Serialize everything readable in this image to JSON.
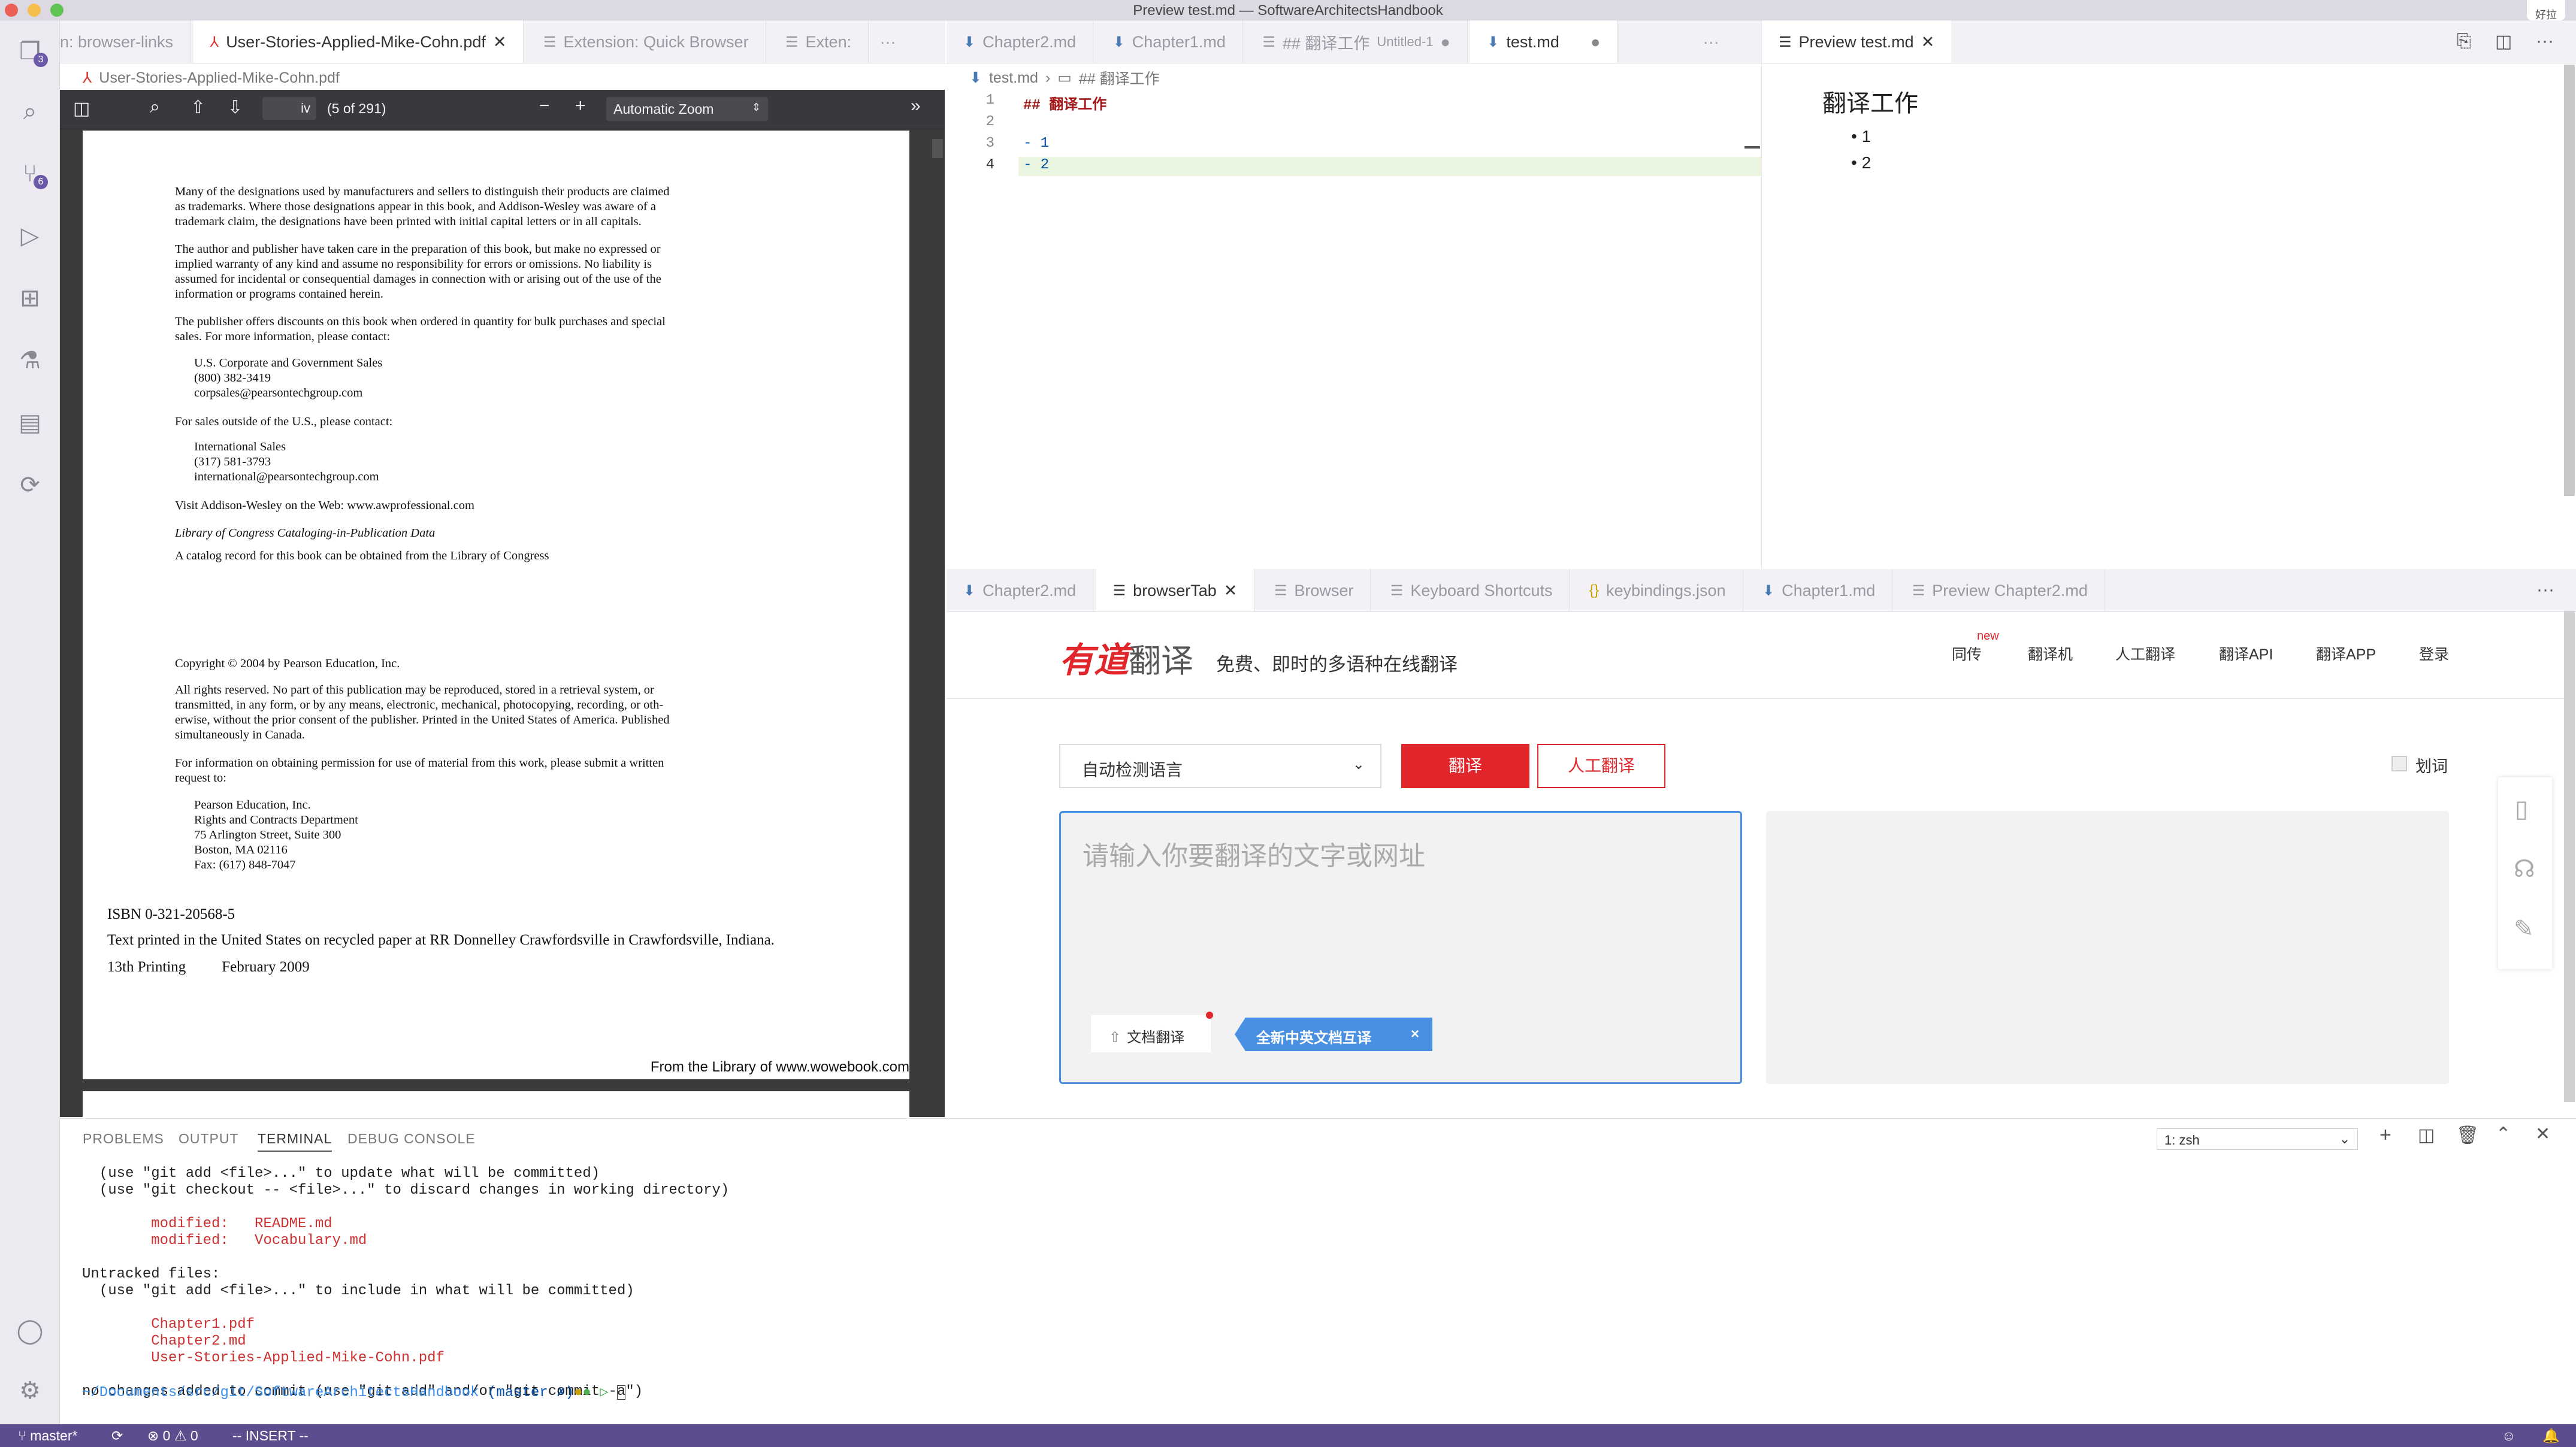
{
  "window_title": "Preview test.md — SoftwareArchitectsHandbook",
  "activity": {
    "badges": {
      "explorer": "3",
      "scm": "6"
    }
  },
  "pdf_group": {
    "tabs": [
      "n: browser-links",
      "User-Stories-Applied-Mike-Cohn.pdf",
      "Extension: Quick Browser",
      "Exten:"
    ],
    "breadcrumb": "User-Stories-Applied-Mike-Cohn.pdf",
    "toolbar": {
      "page_input": "iv",
      "page_count": "(5 of 291)",
      "zoom": "Automatic Zoom"
    },
    "page": {
      "p1": [
        "Many of the designations used by manufacturers and sellers to distinguish their products are claimed",
        "as trademarks. Where those designations appear in this book, and Addison-Wesley was aware of a",
        "trademark claim, the designations have been printed with initial capital letters or in all capitals."
      ],
      "p2": [
        "The author and publisher have taken care in the preparation of this book, but make no expressed or",
        "implied warranty of any kind and assume no responsibility for errors or omissions. No liability is",
        "assumed for incidental or consequential damages in connection with or arising out of the use of the",
        "information or programs contained herein."
      ],
      "p3": [
        "The publisher offers discounts on this book when ordered in quantity for bulk purchases and special",
        "sales. For more information, please contact:"
      ],
      "us_contact": [
        "U.S. Corporate and Government Sales",
        "(800) 382-3419",
        "corpsales@pearsontechgroup.com"
      ],
      "outside": "For sales outside of the U.S., please contact:",
      "intl_contact": [
        "International Sales",
        "(317) 581-3793",
        "international@pearsontechgroup.com"
      ],
      "visit": "Visit Addison-Wesley on the Web: www.awprofessional.com",
      "loc_title": "Library of Congress Cataloging-in-Publication Data",
      "loc_text": "A catalog record for this book can be obtained from the Library of Congress",
      "copyright": "Copyright © 2004 by Pearson Education, Inc.",
      "rights": [
        "All rights reserved. No part of this publication may be reproduced, stored in a retrieval system, or",
        "transmitted, in any form, or by any means, electronic, mechanical, photocopying, recording, or oth-",
        "erwise, without the prior consent of the publisher. Printed in the United States of America. Published",
        "simultaneously in Canada."
      ],
      "permission": [
        "For information on obtaining permission for use of material from this work, please submit a written",
        "request to:"
      ],
      "address": [
        "Pearson Education, Inc.",
        "Rights and Contracts Department",
        "75 Arlington Street, Suite 300",
        "Boston, MA 02116",
        "Fax: (617) 848-7047"
      ],
      "isbn": "ISBN  0-321-20568-5",
      "printed": "Text printed in the United States on recycled paper at RR Donnelley Crawfordsville in Crawfordsville, Indiana.",
      "printing": "13th Printing",
      "printing_date": "February 2009",
      "footer": "From the Library of www.wowebook.com"
    }
  },
  "editor_group": {
    "tabs": [
      "Chapter2.md",
      "Chapter1.md",
      "## 翻译工作",
      "Untitled-1",
      "test.md"
    ],
    "breadcrumb": [
      "test.md",
      "## 翻译工作"
    ],
    "lines": [
      {
        "n": "1",
        "text": "## 翻译工作"
      },
      {
        "n": "2",
        "text": ""
      },
      {
        "n": "3",
        "text": "- 1"
      },
      {
        "n": "4",
        "text": "- 2"
      }
    ]
  },
  "preview_group": {
    "tab": "Preview test.md",
    "heading": "翻译工作",
    "items": [
      "1",
      "2"
    ]
  },
  "browser_group": {
    "tabs": [
      "Chapter2.md",
      "browserTab",
      "Browser",
      "Keyboard Shortcuts",
      "keybindings.json",
      "Chapter1.md",
      "Preview Chapter2.md"
    ],
    "youdao": {
      "logo_red": "有道",
      "logo_gray": "翻译",
      "slogan": "免费、即时的多语种在线翻译",
      "nav": [
        "同传",
        "翻译机",
        "人工翻译",
        "翻译API",
        "翻译APP",
        "登录"
      ],
      "nav_new": "new",
      "lang_select": "自动检测语言",
      "translate_btn": "翻译",
      "human_btn": "人工翻译",
      "word_pick": "划词",
      "placeholder": "请输入你要翻译的文字或网址",
      "doc_btn": "文档翻译",
      "promo": "全新中英文档互译",
      "promo_close": "×"
    }
  },
  "panel": {
    "tabs": [
      "PROBLEMS",
      "OUTPUT",
      "TERMINAL",
      "DEBUG CONSOLE"
    ],
    "terminal_select": "1: zsh",
    "lines": [
      {
        "t": "  (use \"git add <file>...\" to update what will be committed)",
        "c": ""
      },
      {
        "t": "  (use \"git checkout -- <file>...\" to discard changes in working directory)",
        "c": ""
      },
      {
        "t": "",
        "c": ""
      },
      {
        "t": "        modified:   README.md",
        "c": "red"
      },
      {
        "t": "        modified:   Vocabulary.md",
        "c": "red"
      },
      {
        "t": "",
        "c": ""
      },
      {
        "t": "Untracked files:",
        "c": ""
      },
      {
        "t": "  (use \"git add <file>...\" to include in what will be committed)",
        "c": ""
      },
      {
        "t": "",
        "c": ""
      },
      {
        "t": "        Chapter1.pdf",
        "c": "red"
      },
      {
        "t": "        Chapter2.md",
        "c": "red"
      },
      {
        "t": "        User-Stories-Applied-Mike-Cohn.pdf",
        "c": "red"
      },
      {
        "t": "",
        "c": ""
      },
      {
        "t": "no changes added to commit (use \"git add\" and/or \"git commit -a\")",
        "c": ""
      }
    ],
    "prompt": {
      "path": "~/Documents/src/git/SoftwareArchitectsHandbook",
      "branch": "(master ✗)"
    }
  },
  "status": {
    "branch": "master*",
    "errors": "0",
    "warnings": "0",
    "mode": "-- INSERT --"
  },
  "corner": "好拉"
}
